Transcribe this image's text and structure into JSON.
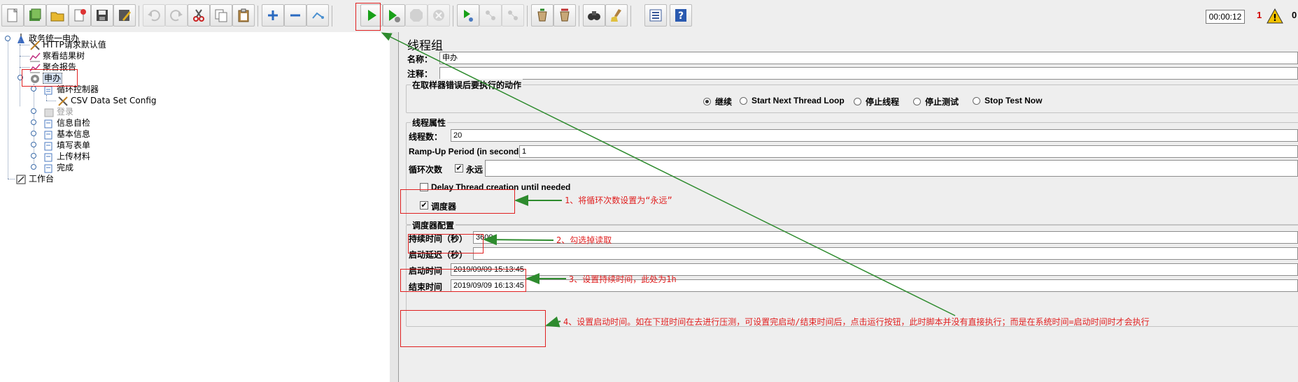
{
  "toolbar": {
    "timer": "00:00:12",
    "error_count": "1",
    "right_counter": "0"
  },
  "tree": {
    "root": "政务统一申办",
    "items": [
      {
        "label": "HTTP请求默认值"
      },
      {
        "label": "察看结果树"
      },
      {
        "label": "聚合报告"
      },
      {
        "label": "申办"
      },
      {
        "label": "循环控制器"
      },
      {
        "label": "CSV Data Set Config"
      },
      {
        "label": "登录"
      },
      {
        "label": "信息自检"
      },
      {
        "label": "基本信息"
      },
      {
        "label": "填写表单"
      },
      {
        "label": "上传材料"
      },
      {
        "label": "完成"
      }
    ],
    "workbench": "工作台"
  },
  "panel": {
    "title": "线程组",
    "name_label": "名称：",
    "name_value": "申办",
    "comment_label": "注释：",
    "comment_value": "",
    "error_action_title": "在取样器错误后要执行的动作",
    "error_options": [
      {
        "label": "继续",
        "selected": true
      },
      {
        "label": "Start Next Thread Loop",
        "selected": false
      },
      {
        "label": "停止线程",
        "selected": false
      },
      {
        "label": "停止测试",
        "selected": false
      },
      {
        "label": "Stop Test Now",
        "selected": false
      }
    ],
    "thread_props_title": "线程属性",
    "threads_label": "线程数：",
    "threads_value": "20",
    "rampup_label": "Ramp-Up Period (in seconds):",
    "rampup_value": "1",
    "loop_label": "循环次数",
    "loop_forever_label": "永远",
    "loop_forever_checked": true,
    "loop_value": "",
    "delay_label": "Delay Thread creation until needed",
    "delay_checked": false,
    "scheduler_label": "调度器",
    "scheduler_checked": true,
    "scheduler_config_title": "调度器配置",
    "duration_label": "持续时间（秒）",
    "duration_value": "3600",
    "startup_delay_label": "启动延迟（秒）",
    "startup_delay_value": "",
    "start_time_label": "启动时间",
    "start_time_value": "2019/09/09 15:13:45",
    "end_time_label": "结束时间",
    "end_time_value": "2019/09/09 16:13:45"
  },
  "annotations": {
    "note1": "1、将循环次数设置为“永远”",
    "note2": "2、勾选掉读取",
    "note3": "3、设置持续时间，此处为1h",
    "note4": "4、设置启动时间。如在下班时间在去进行压测，可设置完启动/结束时间后，点击运行按钮，此时脚本并没有直接执行；而是在系统时间=启动时间时才会执行"
  },
  "colors": {
    "annotation_red": "#e02020",
    "arrow_green": "#2e8b2e",
    "panel_bg": "#eeeeee"
  }
}
